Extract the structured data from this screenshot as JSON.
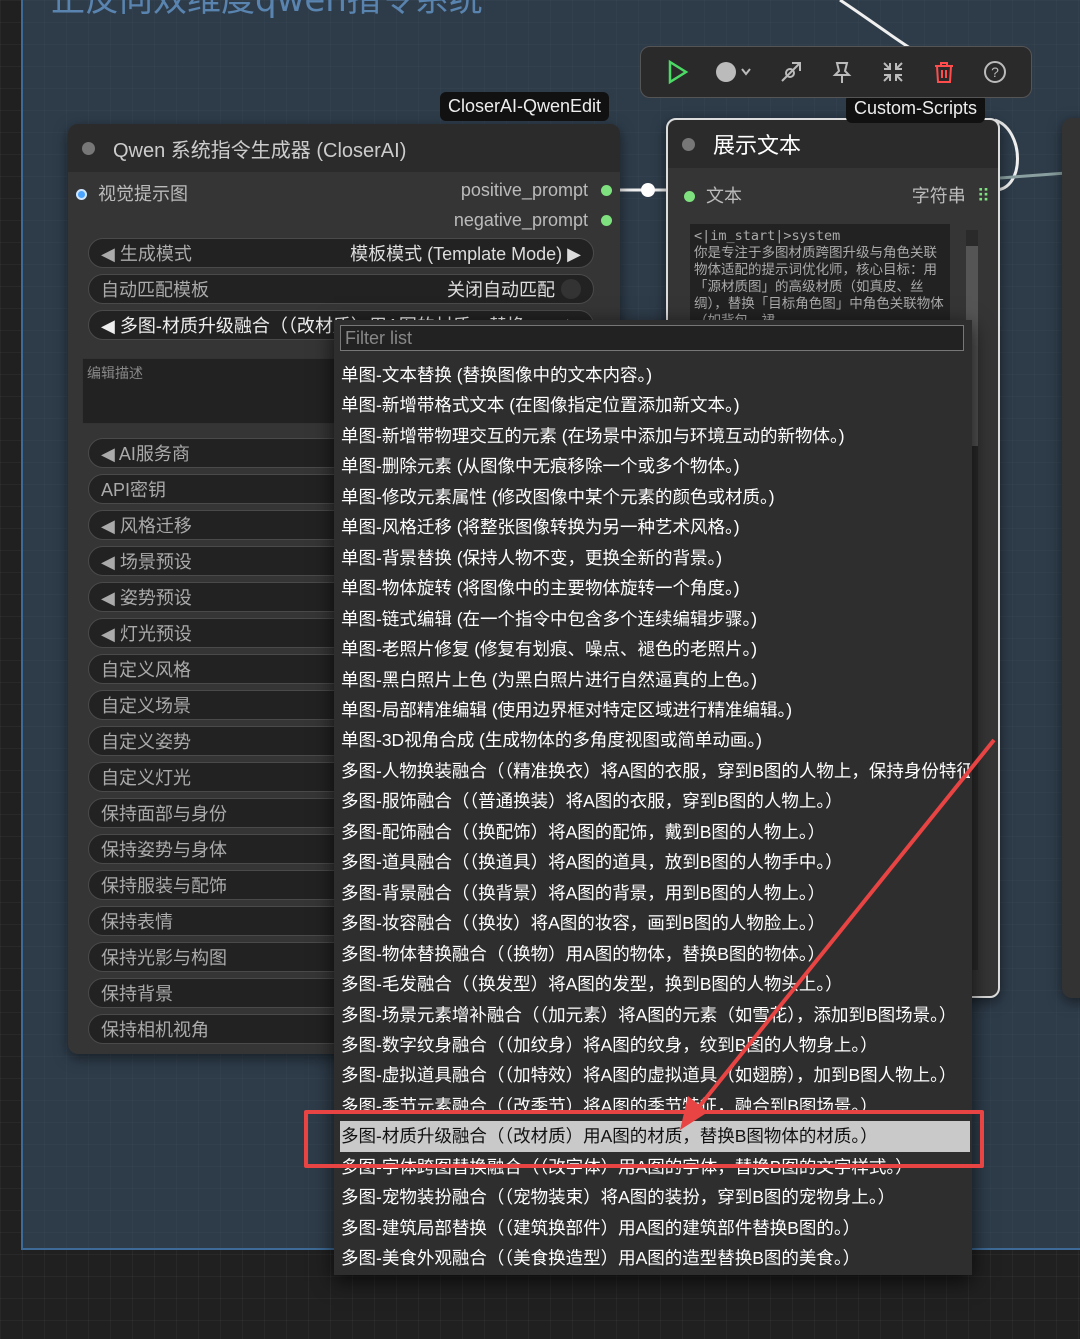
{
  "group": {
    "title": "正反向双维度qwen指令系统"
  },
  "tags": {
    "left": "CloserAI-QwenEdit",
    "right": "Custom-Scripts"
  },
  "toolbar": {
    "icons": [
      "play-icon",
      "record-dot-icon",
      "bypass-icon",
      "pin-icon",
      "collapse-icon",
      "delete-icon",
      "help-icon"
    ]
  },
  "nodeA": {
    "title": "Qwen 系统指令生成器 (CloserAI)",
    "input_label": "视觉提示图",
    "outputs": [
      "positive_prompt",
      "negative_prompt"
    ],
    "widgets": [
      {
        "label": "◀ 生成模式",
        "value": "模板模式 (Template Mode)  ▶"
      },
      {
        "label": "自动匹配模板",
        "value": "关闭自动匹配"
      },
      {
        "label": "◀ 多图-材质升级融合（（改材质）用A图的材质，替换",
        "value": "▶"
      }
    ],
    "desc_placeholder": "编辑描述",
    "widgets2": [
      "◀ AI服务商",
      "API密钥",
      "◀ 风格迁移",
      "◀ 场景预设",
      "◀ 姿势预设",
      "◀ 灯光预设",
      "自定义风格",
      "自定义场景",
      "自定义姿势",
      "自定义灯光",
      "保持面部与身份",
      "保持姿势与身体",
      "保持服装与配饰",
      "保持表情",
      "保持光影与构图",
      "保持背景",
      "保持相机视角"
    ]
  },
  "nodeB": {
    "title": "展示文本",
    "input_label": "文本",
    "output_label": "字符串",
    "content": "<|im_start|>system\n你是专注于多图材质跨图升级与角色关联物体适配的提示词优化师，核心目标：用「源材质图」的高级材质（如真皮、丝绸），替换「目标角色图」中角色关联物体（如背包、裙"
  },
  "menu": {
    "filter_placeholder": "Filter list",
    "selected_index": 25,
    "items": [
      "单图-文本替换 (替换图像中的文本内容。)",
      "单图-新增带格式文本 (在图像指定位置添加新文本。)",
      "单图-新增带物理交互的元素 (在场景中添加与环境互动的新物体。)",
      "单图-删除元素 (从图像中无痕移除一个或多个物体。)",
      "单图-修改元素属性 (修改图像中某个元素的颜色或材质。)",
      "单图-风格迁移 (将整张图像转换为另一种艺术风格。)",
      "单图-背景替换 (保持人物不变，更换全新的背景。)",
      "单图-物体旋转 (将图像中的主要物体旋转一个角度。)",
      "单图-链式编辑 (在一个指令中包含多个连续编辑步骤。)",
      "单图-老照片修复 (修复有划痕、噪点、褪色的老照片。)",
      "单图-黑白照片上色 (为黑白照片进行自然逼真的上色。)",
      "单图-局部精准编辑 (使用边界框对特定区域进行精准编辑。)",
      "单图-3D视角合成 (生成物体的多角度视图或简单动画。)",
      "多图-人物换装融合（（精准换衣）将A图的衣服，穿到B图的人物上，保持身份特征。）",
      "多图-服饰融合（（普通换装）将A图的衣服，穿到B图的人物上。）",
      "多图-配饰融合（（换配饰）将A图的配饰，戴到B图的人物上。）",
      "多图-道具融合（（换道具）将A图的道具，放到B图的人物手中。）",
      "多图-背景融合（（换背景）将A图的背景，用到B图的人物上。）",
      "多图-妆容融合（（换妆）将A图的妆容，画到B图的人物脸上。）",
      "多图-物体替换融合（（换物）用A图的物体，替换B图的物体。）",
      "多图-毛发融合（（换发型）将A图的发型，换到B图的人物头上。）",
      "多图-场景元素增补融合（（加元素）将A图的元素（如雪花），添加到B图场景。）",
      "多图-数字纹身融合（（加纹身）将A图的纹身，纹到B图的人物身上。）",
      "多图-虚拟道具融合（（加特效）将A图的虚拟道具（如翅膀），加到B图人物上。）",
      "多图-季节元素融合（（改季节）将A图的季节特征，融合到B图场景。）",
      "多图-材质升级融合（（改材质）用A图的材质，替换B图物体的材质。）",
      "多图-字体跨图替换融合（（改字体）用A图的字体，替换B图的文字样式。）",
      "多图-宠物装扮融合（（宠物装束）将A图的装扮，穿到B图的宠物身上。）",
      "多图-建筑局部替换（（建筑换部件）用A图的建筑部件替换B图的。）",
      "多图-美食外观融合（（美食换造型）用A图的造型替换B图的美食。）"
    ]
  },
  "colors": {
    "accent_red": "#e84444",
    "socket_green": "#7ee07e",
    "group_blue": "#3d6a96"
  }
}
